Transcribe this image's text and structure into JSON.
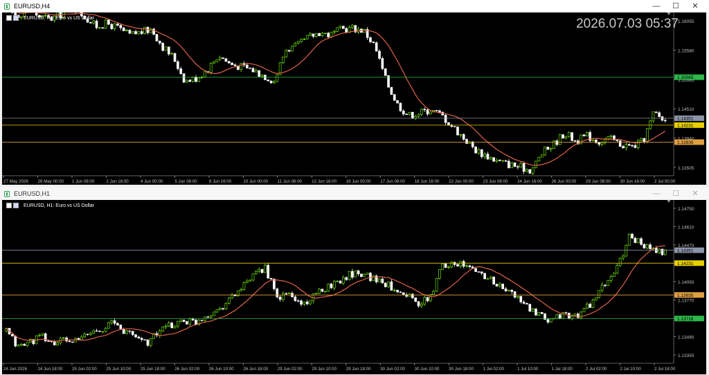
{
  "window1": {
    "title": "EURUSD,H4",
    "header": "EURUSD, H4:  Euro vs US Dollar",
    "clock": "2026.07.03 05:37",
    "controls": {
      "minimize": "—",
      "maximize": "☐",
      "close": "✕"
    },
    "price_labels": [
      "1.16055",
      "1.15580",
      "1.15085",
      "1.14510",
      "1.13940",
      "1.13505"
    ],
    "line_labels": [
      {
        "text": "1.15065",
        "price": 1.15065,
        "color": "#2db84a",
        "text_color": "#000"
      },
      {
        "text": "1.14351",
        "price": 1.14351,
        "color": "#8a94a8",
        "text_color": "#000"
      },
      {
        "text": "1.14231",
        "price": 1.14231,
        "color": "#e8d000",
        "text_color": "#000"
      },
      {
        "text": "1.13935",
        "price": 1.13935,
        "color": "#e0a040",
        "text_color": "#000"
      }
    ],
    "time_labels": [
      "27 May 2026",
      "29 May 00:00",
      "1 Jun 08:00",
      "2 Jun 16:00",
      "4 Jun 00:00",
      "5 Jun 08:00",
      "8 Jun 16:00",
      "10 Jun 00:00",
      "11 Jun 08:00",
      "12 Jun 16:00",
      "16 Jun 00:00",
      "17 Jun 08:00",
      "18 Jun 16:00",
      "22 Jun 00:00",
      "23 Jun 08:00",
      "24 Jun 16:00",
      "26 Jun 00:00",
      "29 Jun 08:00",
      "30 Jun 16:00",
      "2 Jul 00:00"
    ]
  },
  "window2": {
    "title": "EURUSD,H1",
    "header": "EURUSD, H1:  Euro vs US Dollar",
    "controls": {
      "minimize": "—",
      "maximize": "☐",
      "close": "✕"
    },
    "price_labels": [
      "1.14750",
      "1.14610",
      "1.14470",
      "1.14190",
      "1.14050",
      "1.13770",
      "1.13630",
      "1.13490",
      "1.13355"
    ],
    "line_labels": [
      {
        "text": "1.14351",
        "price": 1.14351,
        "color": "#8a94a8",
        "text_color": "#000"
      },
      {
        "text": "1.14231",
        "price": 1.14231,
        "color": "#e8d000",
        "text_color": "#000"
      },
      {
        "text": "1.13935",
        "price": 1.13935,
        "color": "#e0a040",
        "text_color": "#000"
      },
      {
        "text": "1.13716",
        "price": 1.13716,
        "color": "#2db84a",
        "text_color": "#000"
      }
    ],
    "time_labels": [
      "24 Jun 2026",
      "24 Jun 18:00",
      "25 Jun 02:00",
      "25 Jun 10:00",
      "25 Jun 18:00",
      "26 Jun 02:00",
      "26 Jun 10:00",
      "26 Jun 18:00",
      "29 Jun 02:00",
      "29 Jun 10:00",
      "29 Jun 18:00",
      "30 Jun 02:00",
      "30 Jun 10:00",
      "30 Jun 18:00",
      "1 Jul 02:00",
      "1 Jul 10:00",
      "1 Jul 18:00",
      "2 Jul 02:00",
      "2 Jul 10:00",
      "2 Jul 18:00"
    ]
  },
  "colors": {
    "bull": "#7fff00",
    "bear": "#ffffff",
    "ma": "#e0644a",
    "grid": "#1a1a1a",
    "axis_text": "#c0c0c0"
  },
  "chart_data": [
    {
      "type": "candlestick",
      "symbol": "EURUSD",
      "timeframe": "H4",
      "ylim": [
        1.1335,
        1.1612
      ],
      "close_path": [
        1.162,
        1.1615,
        1.1625,
        1.1612,
        1.1608,
        1.1618,
        1.163,
        1.1612,
        1.1595,
        1.16,
        1.1592,
        1.158,
        1.1585,
        1.159,
        1.156,
        1.154,
        1.15,
        1.1505,
        1.152,
        1.1545,
        1.153,
        1.1525,
        1.152,
        1.151,
        1.15,
        1.1555,
        1.156,
        1.1575,
        1.1585,
        1.158,
        1.159,
        1.1592,
        1.1588,
        1.156,
        1.15,
        1.146,
        1.144,
        1.1445,
        1.145,
        1.144,
        1.142,
        1.14,
        1.138,
        1.137,
        1.136,
        1.1355,
        1.135,
        1.1345,
        1.1375,
        1.139,
        1.141,
        1.1395,
        1.1405,
        1.1395,
        1.14,
        1.139,
        1.1385,
        1.1395,
        1.1445,
        1.143
      ]
    },
    {
      "type": "candlestick",
      "symbol": "EURUSD",
      "timeframe": "H1",
      "ylim": [
        1.133,
        1.1478
      ],
      "close_path": [
        1.136,
        1.1345,
        1.135,
        1.1355,
        1.1348,
        1.1352,
        1.135,
        1.1358,
        1.1362,
        1.1368,
        1.136,
        1.1355,
        1.135,
        1.136,
        1.1365,
        1.137,
        1.1368,
        1.1375,
        1.138,
        1.139,
        1.14,
        1.141,
        1.142,
        1.139,
        1.1395,
        1.1385,
        1.139,
        1.14,
        1.1405,
        1.1412,
        1.1415,
        1.141,
        1.1405,
        1.14,
        1.1395,
        1.1385,
        1.139,
        1.142,
        1.1425,
        1.142,
        1.1415,
        1.141,
        1.14,
        1.1395,
        1.1385,
        1.1375,
        1.137,
        1.1375,
        1.1372,
        1.1378,
        1.139,
        1.1405,
        1.142,
        1.145,
        1.144,
        1.1435,
        1.1432
      ]
    }
  ]
}
